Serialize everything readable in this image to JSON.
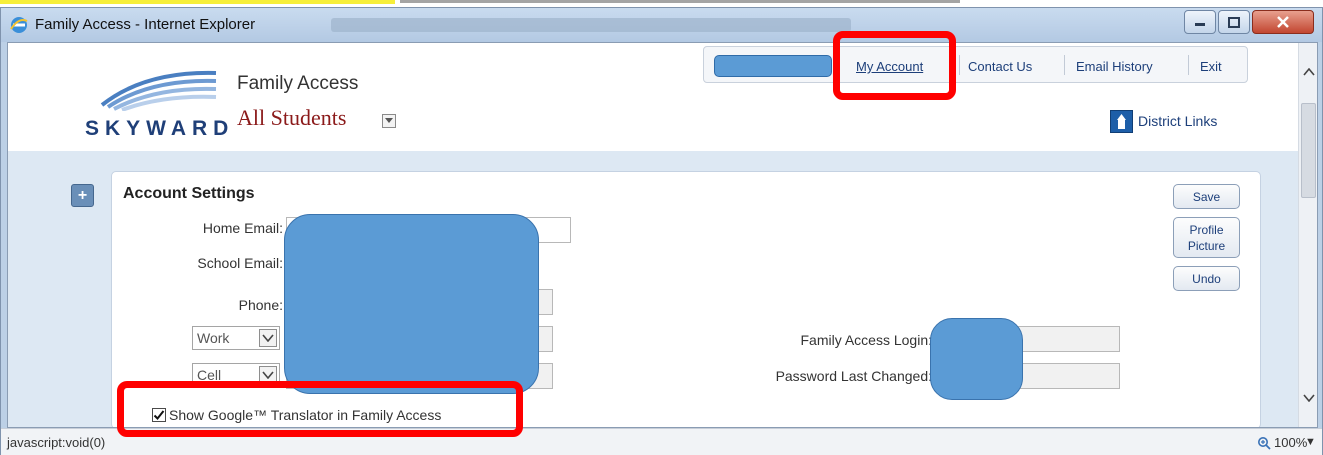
{
  "window": {
    "title": "Family Access - Internet Explorer"
  },
  "header": {
    "app_name": "Family Access",
    "student_selector": "All Students",
    "logo_text": "SKYWARD",
    "district_links": "District Links"
  },
  "nav": {
    "my_account": "My Account",
    "contact_us": "Contact Us",
    "email_history": "Email History",
    "exit": "Exit"
  },
  "account_settings": {
    "title": "Account Settings",
    "home_email_label": "Home Email:",
    "school_email_label": "School Email:",
    "phone_label": "Phone:",
    "phone_type_1": "Work",
    "phone_type_2": "Cell",
    "family_access_login_label": "Family Access Login:",
    "password_last_changed_label": "Password Last Changed:",
    "buttons": {
      "save": "Save",
      "profile_picture": "Profile Picture",
      "undo": "Undo"
    },
    "google_translator_label": "Show Google™ Translator in Family Access",
    "google_translator_checked": true
  },
  "statusbar": {
    "text": "javascript:void(0)",
    "zoom": "100%"
  },
  "colors": {
    "redaction": "#5b9bd5",
    "annotation": "#ff0000",
    "highlight": "#f6ee3a",
    "student_name": "#8b1a1a",
    "link": "#1d3f7a"
  },
  "icons": {
    "browser": "ie-icon",
    "district": "district-links-icon",
    "expand": "plus-icon",
    "zoom": "zoom-icon"
  }
}
